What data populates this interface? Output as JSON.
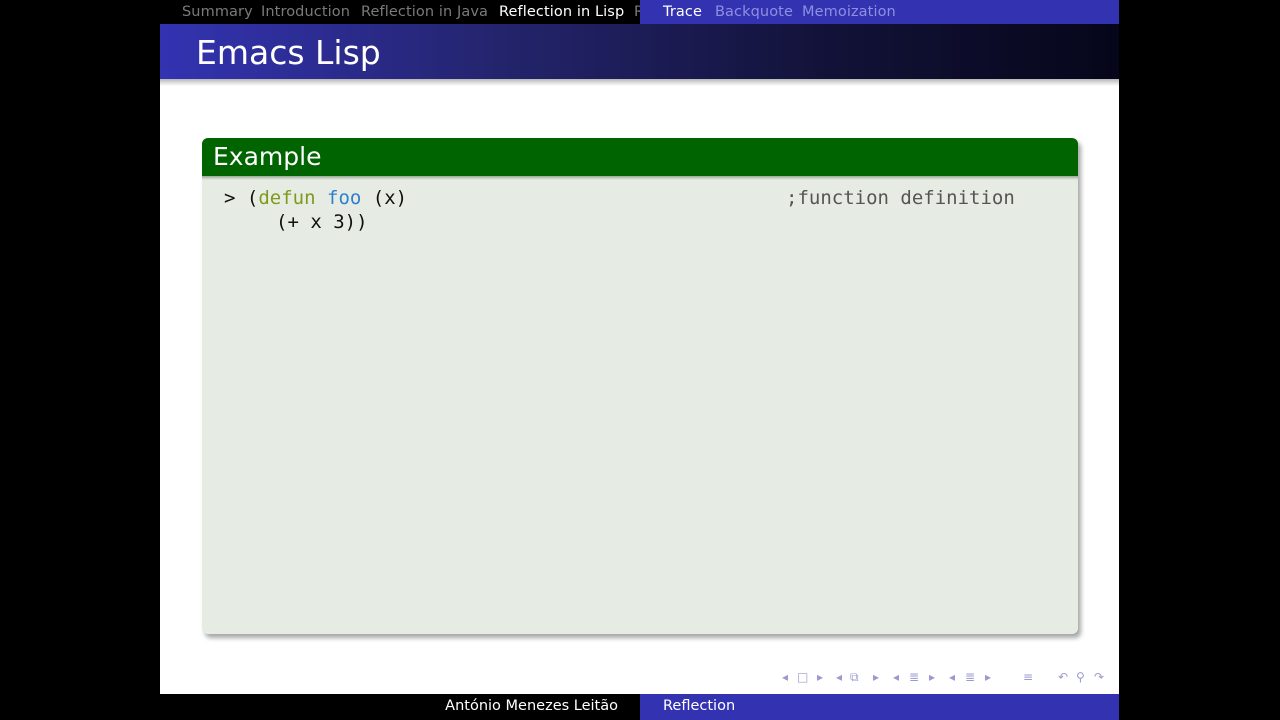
{
  "nav": {
    "sections": [
      "Summary",
      "Introduction",
      "Reflection in Java",
      "Reflection in Lisp",
      "R"
    ],
    "subsections": [
      "Trace",
      "Backquote",
      "Memoization"
    ]
  },
  "frame": {
    "title": "Emacs Lisp"
  },
  "block": {
    "title": "Example",
    "code": {
      "prompt": ">",
      "open": "(",
      "keyword": "defun",
      "function": "foo",
      "args": "(x)",
      "comment": ";function definition",
      "line2": "(+ x 3))"
    }
  },
  "footer": {
    "author": "António Menezes Leitão",
    "title": "Reflection"
  },
  "colors": {
    "header_blue": "#3333b2",
    "block_green": "#006400",
    "block_bg": "#e6ece3"
  },
  "icons": [
    "nav-frame-left-icon",
    "nav-frame-icon",
    "nav-frame-right-icon",
    "nav-section-left-icon",
    "nav-section-icon",
    "nav-section-right-icon",
    "nav-subsection-left-icon",
    "nav-subsection-icon",
    "nav-subsection-right-icon",
    "nav-slide-left-icon",
    "nav-slide-icon",
    "nav-slide-right-icon",
    "nav-align-icon",
    "nav-back-icon",
    "nav-search-icon",
    "nav-forward-icon"
  ]
}
